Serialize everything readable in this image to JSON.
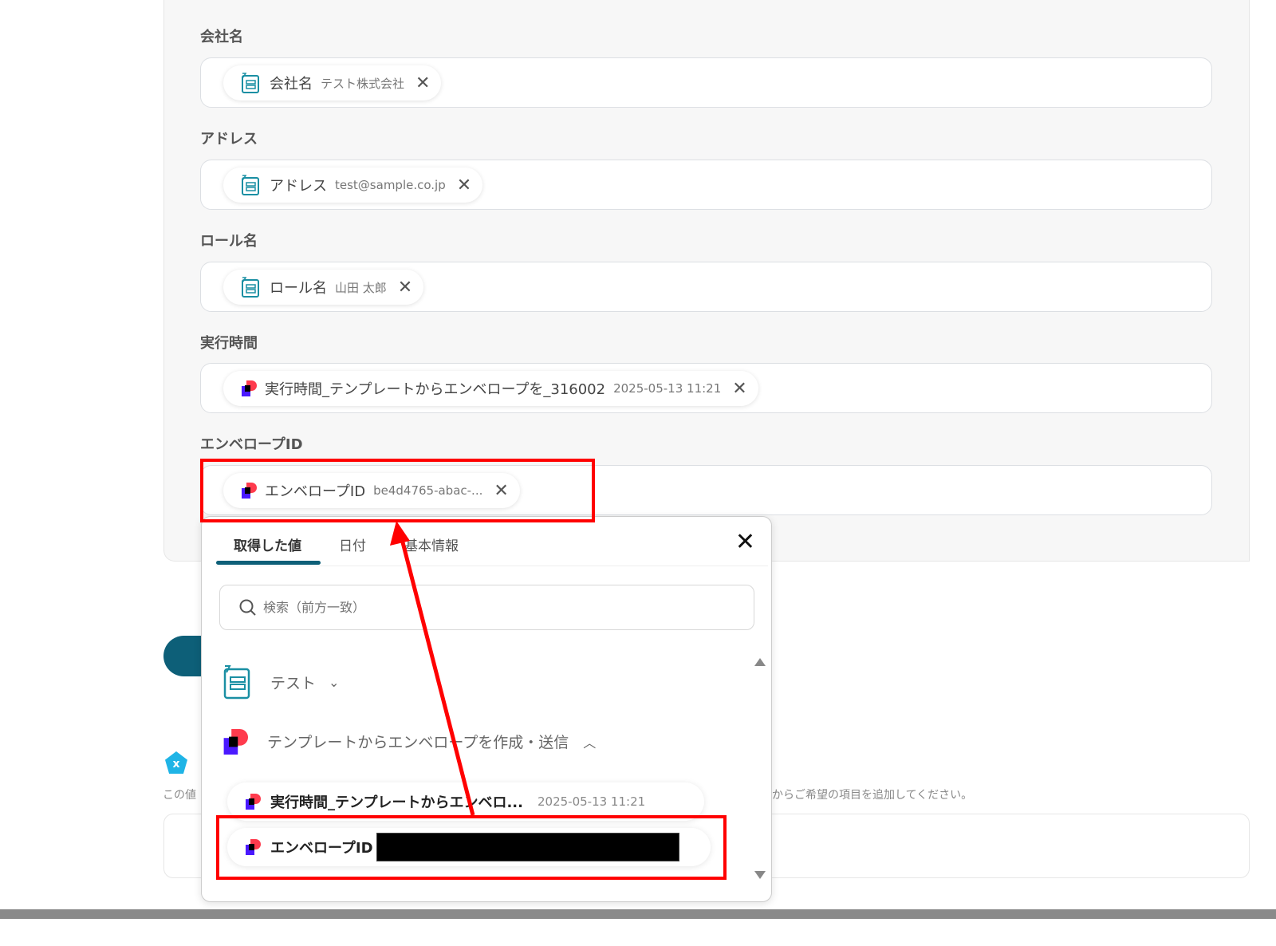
{
  "fields": [
    {
      "label": "会社名",
      "chip_name": "会社名",
      "chip_value": "テスト株式会社",
      "icon": "sheet-icon"
    },
    {
      "label": "アドレス",
      "chip_name": "アドレス",
      "chip_value": "test@sample.co.jp",
      "icon": "sheet-icon"
    },
    {
      "label": "ロール名",
      "chip_name": "ロール名",
      "chip_value": "山田 太郎",
      "icon": "sheet-icon"
    },
    {
      "label": "実行時間",
      "chip_name": "実行時間_テンプレートからエンベロープを_316002",
      "chip_value": "2025-05-13 11:21",
      "icon": "docusign-icon"
    },
    {
      "label": "エンベロープID",
      "chip_name": "エンベロープID",
      "chip_value": "be4d4765-abac-...",
      "icon": "docusign-icon"
    }
  ],
  "remove_glyph": "✕",
  "dropdown": {
    "tabs": [
      "取得した値",
      "日付",
      "基本情報"
    ],
    "close_glyph": "✕",
    "search_placeholder": "検索（前方一致）",
    "groups": [
      {
        "label": "テスト",
        "expanded": false
      },
      {
        "label": "テンプレートからエンベロープを作成・送信",
        "expanded": true
      }
    ],
    "items": [
      {
        "name": "実行時間_テンプレートからエンベロ...",
        "value": "2025-05-13 11:21"
      },
      {
        "name": "エンベロープID",
        "value": ""
      }
    ]
  },
  "background": {
    "hint_left": "この値",
    "hint_right": "からご希望の項目を追加してください。"
  },
  "colors": {
    "accent": "#0d5f78",
    "highlight": "#ff0000",
    "brand_red": "#ff3b4d",
    "brand_blue": "#4a19ff"
  }
}
